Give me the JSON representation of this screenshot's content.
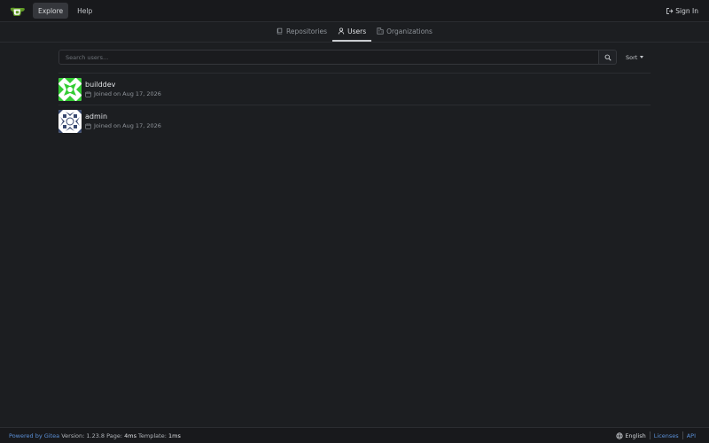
{
  "nav": {
    "explore": "Explore",
    "help": "Help",
    "sign_in": "Sign In"
  },
  "tabs": [
    {
      "label": "Repositories",
      "icon": "repo-icon"
    },
    {
      "label": "Users",
      "icon": "person-icon"
    },
    {
      "label": "Organizations",
      "icon": "organization-icon"
    }
  ],
  "search": {
    "placeholder": "Search users...",
    "value": "",
    "sort_label": "Sort"
  },
  "users": [
    {
      "name": "builddev",
      "joined": "Joined on Aug 17, 2026",
      "avatar_color": "#33cc33"
    },
    {
      "name": "admin",
      "joined": "Joined on Aug 17, 2026",
      "avatar_color": "#3a4a70"
    }
  ],
  "footer": {
    "powered_by": "Powered by Gitea",
    "version_text": "Version: 1.23.8 Page:",
    "page_time": "4ms",
    "template_label": "Template:",
    "template_time": "1ms",
    "language": "English",
    "licenses": "Licenses",
    "api": "API"
  },
  "colors": {
    "background": "#1c1e21",
    "header": "#18191c",
    "link": "#5a8fd6",
    "brand_green": "#609926"
  }
}
